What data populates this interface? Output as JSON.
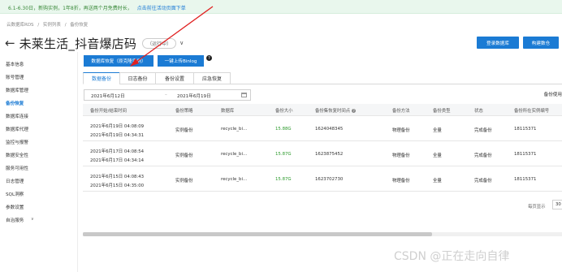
{
  "banner": {
    "items": [
      "6.1-6.30日，新购实例，1年8折，再送两个月免费时长，",
      "点击前往活动页面下单"
    ]
  },
  "breadcrumb": [
    "云数据库RDS",
    "/",
    "实例列表",
    "/",
    "备份恢复"
  ],
  "title": {
    "back": "←",
    "name": "未莱生活_抖音爆店码",
    "status": "（运行中）",
    "chevron": "∨"
  },
  "header_buttons": {
    "login_db": "登录数据库",
    "build_warehouse": "构建数仓"
  },
  "sidebar": {
    "items": [
      {
        "label": "基本信息"
      },
      {
        "label": "账号管理"
      },
      {
        "label": "数据库管理"
      },
      {
        "label": "备份恢复",
        "active": true
      },
      {
        "label": "数据库连接"
      },
      {
        "label": "数据库代理"
      },
      {
        "label": "监控与报警"
      },
      {
        "label": "数据安全性"
      },
      {
        "label": "服务可用性"
      },
      {
        "label": "日志管理"
      },
      {
        "label": "SQL洞察"
      },
      {
        "label": "参数设置"
      },
      {
        "label": "自治服务",
        "caret": "∨"
      }
    ]
  },
  "actions": {
    "restore": "数据库恢复（原克隆实例）",
    "upload_binlog": "一键上传Binlog",
    "help": "?"
  },
  "tabs": [
    "数据备份",
    "日志备份",
    "备份设置",
    "应急恢复"
  ],
  "filter": {
    "start": "2021年6月12日",
    "sep": "–",
    "end": "2021年6月19日",
    "usage_label": "备份使用"
  },
  "table": {
    "headers": [
      "备份开始/结束时间",
      "备份策略",
      "数据库",
      "备份大小",
      "备份集恢复时间点",
      "备份方法",
      "备份类型",
      "状态",
      "备份所在实例编号"
    ],
    "help_mark": "?",
    "rows": [
      {
        "start": "2021年6月19日 04:08:09",
        "end": "2021年6月19日 04:34:31",
        "policy": "实例备份",
        "db": "recycle_bi...",
        "size": "15.88G",
        "restore_point": "1624048345",
        "method": "物理备份",
        "type": "全量",
        "status": "完成备份",
        "instance": "18115371"
      },
      {
        "start": "2021年6月17日 04:08:54",
        "end": "2021年6月17日 04:34:14",
        "policy": "实例备份",
        "db": "recycle_bi...",
        "size": "15.87G",
        "restore_point": "1623875452",
        "method": "物理备份",
        "type": "全量",
        "status": "完成备份",
        "instance": "18115371"
      },
      {
        "start": "2021年6月15日 04:08:43",
        "end": "2021年6月15日 04:35:00",
        "policy": "实例备份",
        "db": "recycle_bi...",
        "size": "15.87G",
        "restore_point": "1623702730",
        "method": "物理备份",
        "type": "全量",
        "status": "完成备份",
        "instance": "18115371"
      }
    ]
  },
  "pager": {
    "label": "每页显示",
    "value": "30"
  },
  "watermark": "CSDN @正在走向自律",
  "colors": {
    "primary": "#1b7bd4",
    "size_green": "#2c9a2c",
    "annotation": "#e02020"
  }
}
